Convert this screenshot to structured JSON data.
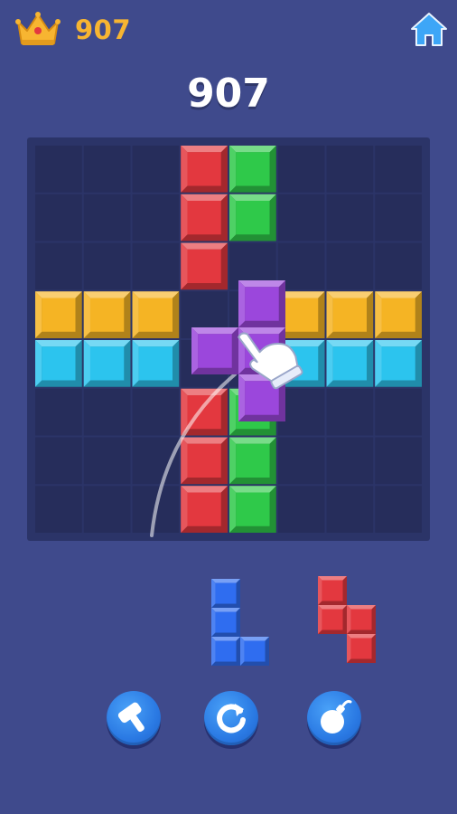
{
  "header": {
    "best_score": "907",
    "crown_icon": "crown-icon",
    "home_icon": "home-icon"
  },
  "score": {
    "current": "907"
  },
  "board": {
    "rows": 8,
    "cols": 8,
    "cells": [
      {
        "r": 0,
        "c": 3,
        "color": "red"
      },
      {
        "r": 0,
        "c": 4,
        "color": "green"
      },
      {
        "r": 1,
        "c": 3,
        "color": "red"
      },
      {
        "r": 1,
        "c": 4,
        "color": "green"
      },
      {
        "r": 2,
        "c": 3,
        "color": "red"
      },
      {
        "r": 3,
        "c": 0,
        "color": "yellow"
      },
      {
        "r": 3,
        "c": 1,
        "color": "yellow"
      },
      {
        "r": 3,
        "c": 2,
        "color": "yellow"
      },
      {
        "r": 3,
        "c": 5,
        "color": "yellow"
      },
      {
        "r": 3,
        "c": 6,
        "color": "yellow"
      },
      {
        "r": 3,
        "c": 7,
        "color": "yellow"
      },
      {
        "r": 4,
        "c": 0,
        "color": "cyan"
      },
      {
        "r": 4,
        "c": 1,
        "color": "cyan"
      },
      {
        "r": 4,
        "c": 2,
        "color": "cyan"
      },
      {
        "r": 4,
        "c": 5,
        "color": "cyan"
      },
      {
        "r": 4,
        "c": 6,
        "color": "cyan"
      },
      {
        "r": 4,
        "c": 7,
        "color": "cyan"
      },
      {
        "r": 5,
        "c": 3,
        "color": "red"
      },
      {
        "r": 5,
        "c": 4,
        "color": "green"
      },
      {
        "r": 6,
        "c": 3,
        "color": "red"
      },
      {
        "r": 6,
        "c": 4,
        "color": "green"
      },
      {
        "r": 7,
        "c": 3,
        "color": "red"
      },
      {
        "r": 7,
        "c": 4,
        "color": "green"
      }
    ],
    "dragging_piece": {
      "color": "purple",
      "cells": [
        [
          0,
          1
        ],
        [
          1,
          0
        ],
        [
          1,
          1
        ],
        [
          2,
          1
        ]
      ]
    },
    "hand_icon": "pointer-hand-icon"
  },
  "tray": {
    "pieces": [
      {
        "name": "blue-l-piece",
        "color": "blue",
        "cells": [
          [
            0,
            0
          ],
          [
            1,
            0
          ],
          [
            2,
            0
          ],
          [
            2,
            1
          ]
        ]
      },
      {
        "name": "red-s-piece",
        "color": "red",
        "cells": [
          [
            0,
            0
          ],
          [
            1,
            0
          ],
          [
            1,
            1
          ],
          [
            2,
            1
          ]
        ]
      }
    ]
  },
  "powerups": [
    {
      "name": "hammer-button",
      "icon": "hammer-icon"
    },
    {
      "name": "refresh-button",
      "icon": "refresh-icon"
    },
    {
      "name": "bomb-button",
      "icon": "bomb-icon"
    }
  ],
  "colors": {
    "background": "#3f4a8c",
    "board": "#2b3468",
    "grid_cell": "#262d5b",
    "red": "#e3383f",
    "green": "#2fc94a",
    "yellow": "#f5b424",
    "cyan": "#2cc4ee",
    "purple": "#9b47dc",
    "blue": "#2f6df0",
    "score_gold": "#f7b531"
  }
}
